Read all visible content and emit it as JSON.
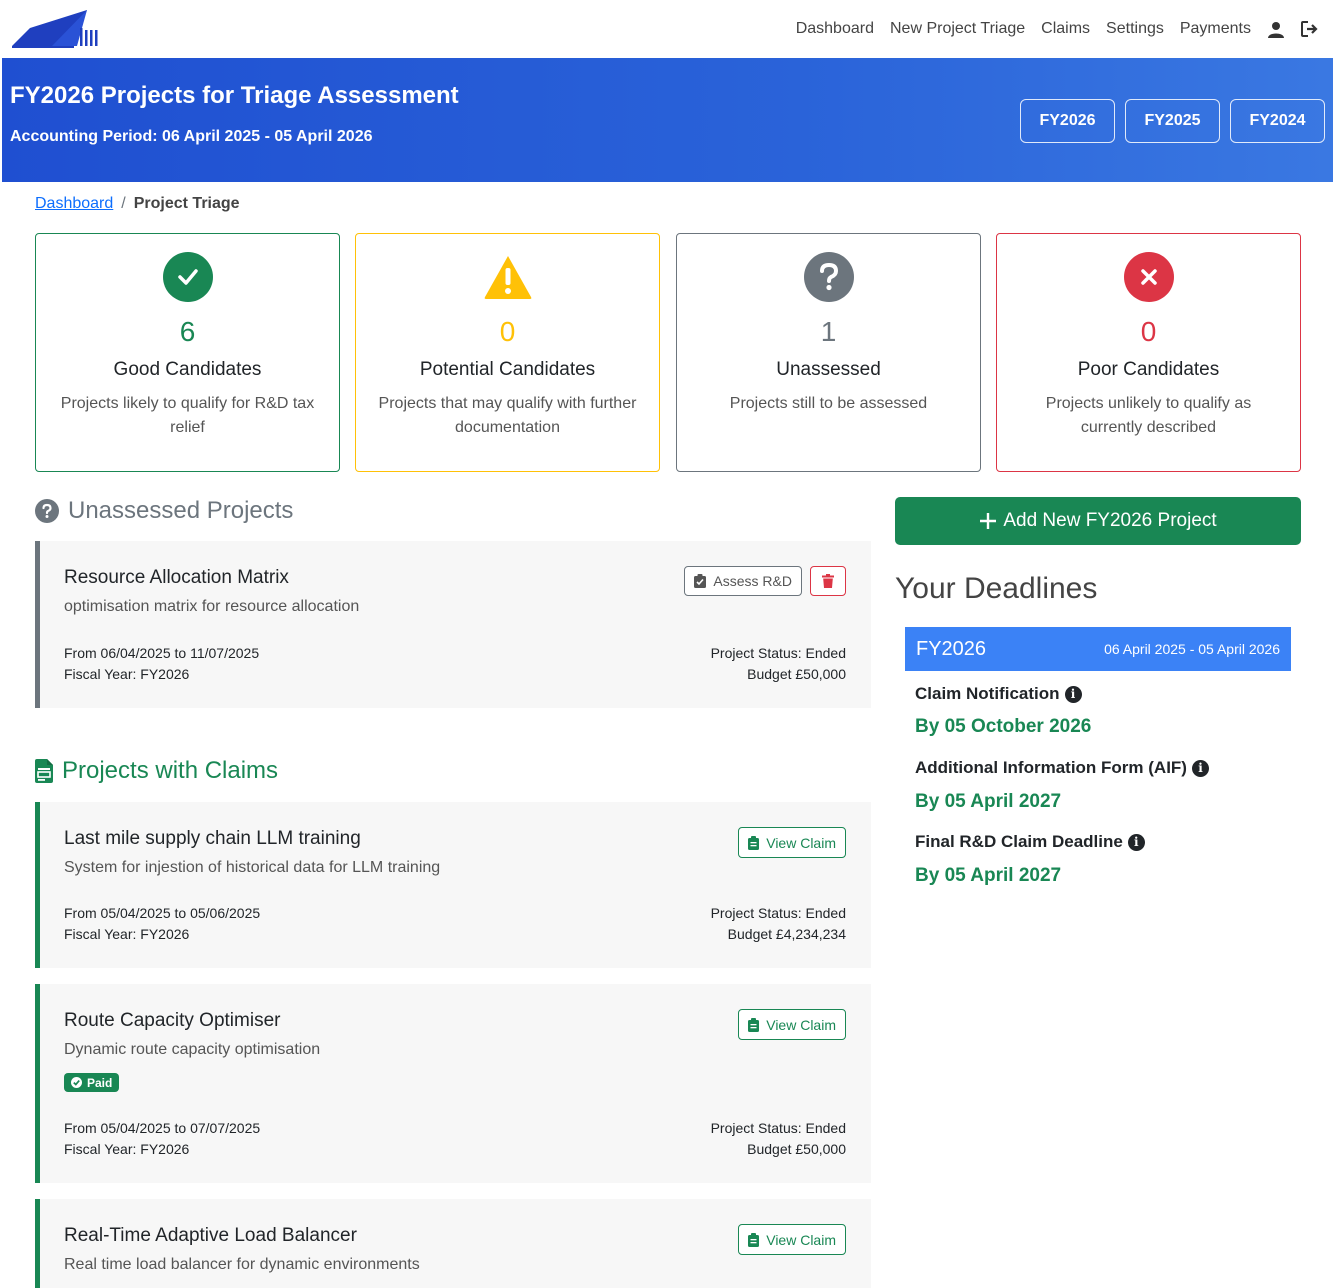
{
  "nav": {
    "links": [
      "Dashboard",
      "New Project Triage",
      "Claims",
      "Settings",
      "Payments"
    ],
    "user_icon": "user-icon",
    "logout_icon": "logout-icon"
  },
  "hero": {
    "title": "FY2026 Projects for Triage Assessment",
    "subtitle": "Accounting Period: 06 April 2025 - 05 April 2026",
    "fy_buttons": [
      "FY2026",
      "FY2025",
      "FY2024"
    ]
  },
  "breadcrumb": {
    "link": "Dashboard",
    "separator": "/",
    "current": "Project Triage"
  },
  "stats": [
    {
      "icon": "check-circle-icon",
      "count": "6",
      "label": "Good Candidates",
      "desc": "Projects likely to qualify for R&D tax relief",
      "color": "#198754"
    },
    {
      "icon": "warning-triangle-icon",
      "count": "0",
      "label": "Potential Candidates",
      "desc": "Projects that may qualify with further documentation",
      "color": "#ffc107"
    },
    {
      "icon": "question-circle-icon",
      "count": "1",
      "label": "Unassessed",
      "desc": "Projects still to be assessed",
      "color": "#6c757d"
    },
    {
      "icon": "x-circle-icon",
      "count": "0",
      "label": "Poor Candidates",
      "desc": "Projects unlikely to qualify as currently described",
      "color": "#dc3545"
    }
  ],
  "unassessed": {
    "heading": "Unassessed Projects",
    "projects": [
      {
        "title": "Resource Allocation Matrix",
        "desc": "optimisation matrix for resource allocation",
        "dates": "From 06/04/2025 to 11/07/2025",
        "fiscal": "Fiscal Year: FY2026",
        "status": "Project Status: Ended",
        "budget": "Budget £50,000",
        "assess_label": "Assess R&D"
      }
    ]
  },
  "claims": {
    "heading": "Projects with Claims",
    "view_label": "View Claim",
    "paid_label": "Paid",
    "projects": [
      {
        "title": "Last mile supply chain LLM training",
        "desc": "System for injestion of historical data for LLM training",
        "dates": "From 05/04/2025 to 05/06/2025",
        "fiscal": "Fiscal Year: FY2026",
        "status": "Project Status: Ended",
        "budget": "Budget £4,234,234"
      },
      {
        "title": "Route Capacity Optimiser",
        "desc": "Dynamic route capacity optimisation",
        "dates": "From 05/04/2025 to 07/07/2025",
        "fiscal": "Fiscal Year: FY2026",
        "status": "Project Status: Ended",
        "budget": "Budget £50,000",
        "paid": true
      },
      {
        "title": "Real-Time Adaptive Load Balancer",
        "desc": "Real time load balancer for dynamic environments"
      }
    ]
  },
  "sidebar": {
    "add_label": "Add New FY2026 Project",
    "deadlines_title": "Your Deadlines",
    "fy_label": "FY2026",
    "fy_range": "06 April 2025 - 05 April 2026",
    "deadlines": [
      {
        "label": "Claim Notification",
        "date": "By 05 October 2026"
      },
      {
        "label": "Additional Information Form (AIF)",
        "date": "By 05 April 2027"
      },
      {
        "label": "Final R&D Claim Deadline",
        "date": "By 05 April 2027"
      }
    ]
  },
  "colors": {
    "accent_blue": "#1f4fd1",
    "success": "#198754",
    "warning": "#ffc107",
    "secondary": "#6c757d",
    "danger": "#dc3545",
    "banner_blue": "#3b82f6"
  }
}
